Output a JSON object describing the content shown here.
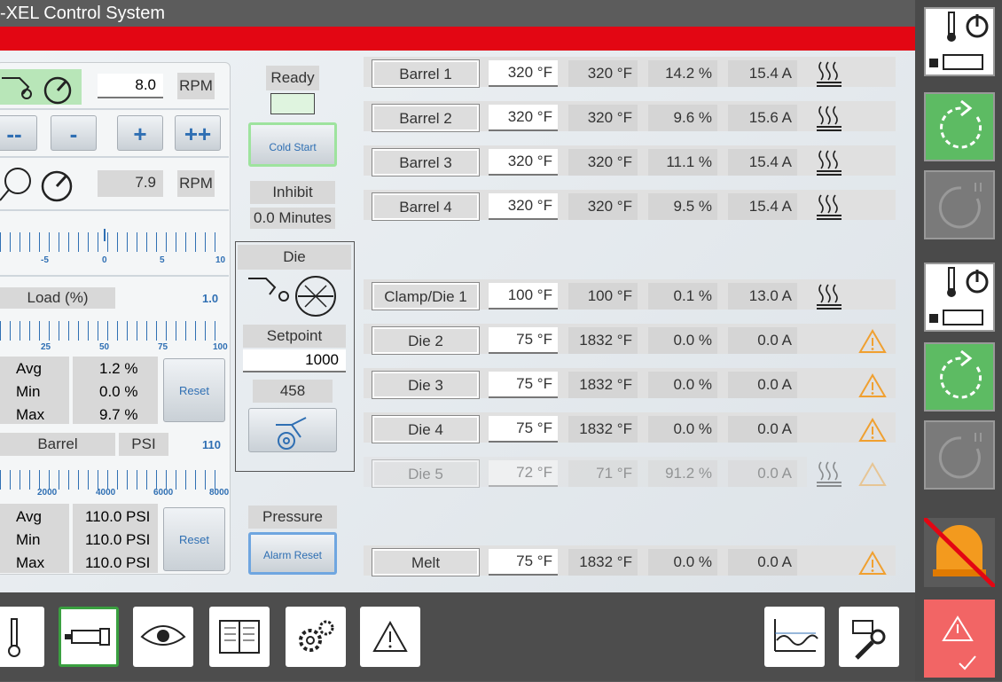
{
  "app": {
    "title": "-XEL Control System"
  },
  "screw": {
    "set_rpm": "8.0",
    "rpm_unit": "RPM",
    "actual_rpm": "7.9",
    "buttons": [
      "--",
      "-",
      "+",
      "++"
    ],
    "scale1": [
      "-5",
      "0",
      "5",
      "10"
    ],
    "load_label": "Load (%)",
    "load_value": "1.0",
    "scale2": [
      "25",
      "50",
      "75",
      "100"
    ],
    "load_stats": {
      "avg_label": "Avg",
      "avg": "1.2 %",
      "min_label": "Min",
      "min": "0.0 %",
      "max_label": "Max",
      "max": "9.7 %"
    },
    "reset1": "Reset",
    "barrel_label": "Barrel",
    "psi_label": "PSI",
    "psi_value": "110",
    "scale3": [
      "2000",
      "4000",
      "6000",
      "8000"
    ],
    "psi_stats": {
      "avg_label": "Avg",
      "avg": "110.0 PSI",
      "min_label": "Min",
      "min": "110.0 PSI",
      "max_label": "Max",
      "max": "110.0 PSI"
    },
    "reset2": "Reset"
  },
  "status": {
    "ready": "Ready",
    "cold_start": "Cold Start",
    "inhibit": "Inhibit",
    "inhibit_time": "0.0 Minutes",
    "die_label": "Die",
    "setpoint_label": "Setpoint",
    "setpoint": "1000",
    "actual": "458",
    "pressure": "Pressure",
    "alarm_reset": "Alarm Reset"
  },
  "zones": [
    {
      "name": "Barrel 1",
      "set": "320 °F",
      "act": "320 °F",
      "pct": "14.2 %",
      "amps": "15.4 A",
      "icon": "heater-icon"
    },
    {
      "name": "Barrel 2",
      "set": "320 °F",
      "act": "320 °F",
      "pct": "9.6 %",
      "amps": "15.6 A",
      "icon": "heater-icon"
    },
    {
      "name": "Barrel 3",
      "set": "320 °F",
      "act": "320 °F",
      "pct": "11.1 %",
      "amps": "15.4 A",
      "icon": "heater-icon"
    },
    {
      "name": "Barrel 4",
      "set": "320 °F",
      "act": "320 °F",
      "pct": "9.5 %",
      "amps": "15.4 A",
      "icon": "heater-icon"
    },
    {
      "name": "Clamp/Die 1",
      "set": "100 °F",
      "act": "100 °F",
      "pct": "0.1 %",
      "amps": "13.0 A",
      "icon": "heater-icon"
    },
    {
      "name": "Die 2",
      "set": "75 °F",
      "act": "1832 °F",
      "pct": "0.0 %",
      "amps": "0.0 A",
      "icon": "warning-icon"
    },
    {
      "name": "Die 3",
      "set": "75 °F",
      "act": "1832 °F",
      "pct": "0.0 %",
      "amps": "0.0 A",
      "icon": "warning-icon"
    },
    {
      "name": "Die 4",
      "set": "75 °F",
      "act": "1832 °F",
      "pct": "0.0 %",
      "amps": "0.0 A",
      "icon": "warning-icon"
    },
    {
      "name": "Die 5",
      "set": "72 °F",
      "act": "71 °F",
      "pct": "91.2 %",
      "amps": "0.0 A",
      "icon": "heater-icon"
    },
    {
      "name": "Melt",
      "set": "75 °F",
      "act": "1832 °F",
      "pct": "0.0 %",
      "amps": "0.0 A",
      "icon": "warning-icon"
    }
  ],
  "colors": {
    "accent_red": "#e30613",
    "green": "#5dbb63",
    "warning": "#f0a030",
    "blue": "#2f6fb3"
  }
}
